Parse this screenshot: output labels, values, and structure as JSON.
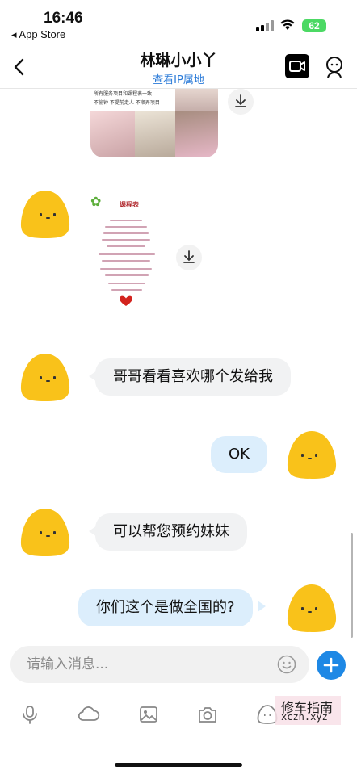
{
  "status": {
    "time": "16:46",
    "back_app": "◂ App Store",
    "battery": "62"
  },
  "nav": {
    "title": "林琳小小丫",
    "subtitle": "查看IP属地"
  },
  "image_message": {
    "caption_line1": "所有服务项目和课程表一致",
    "caption_line2": "不偷钟 不提前走人 不顺弄项目"
  },
  "course_image": {
    "title": "课程表"
  },
  "messages": [
    {
      "side": "in",
      "text": "哥哥看看喜欢哪个发给我"
    },
    {
      "side": "out",
      "text": "OK"
    },
    {
      "side": "in",
      "text": "可以帮您预约妹妹"
    },
    {
      "side": "out",
      "text": "你们这个是做全国的?"
    }
  ],
  "input": {
    "placeholder": "请输入消息..."
  },
  "toolbar": {
    "icons": [
      "microphone-icon",
      "cloud-icon",
      "image-icon",
      "camera-icon",
      "emoji-icon"
    ]
  },
  "watermark": {
    "line1": "修车指南",
    "line2": "xczn.xyz"
  },
  "colors": {
    "accent": "#1e88e5",
    "link": "#2b7bd8",
    "bubble_in": "#f1f2f3",
    "bubble_out": "#dceefc",
    "avatar": "#f9c21a"
  }
}
